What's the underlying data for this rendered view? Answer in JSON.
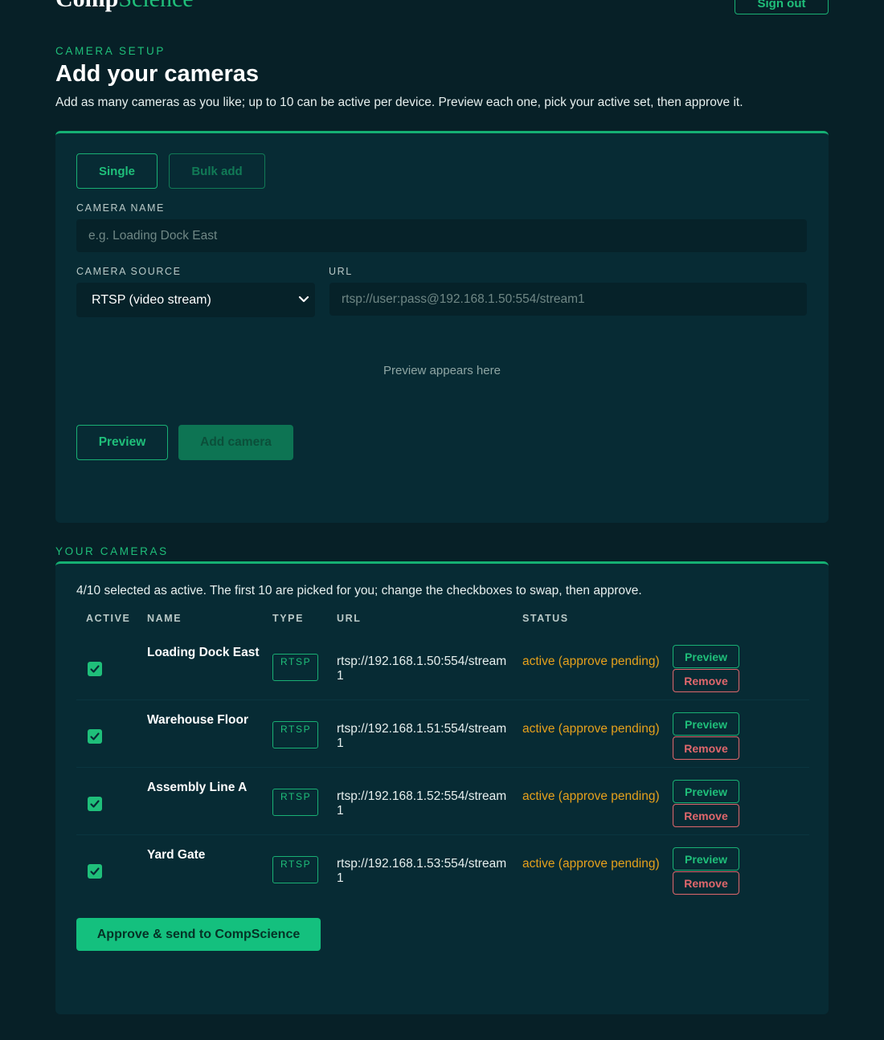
{
  "header": {
    "logo_part1": "Comp",
    "logo_part2": "Science",
    "signout_label": "Sign out"
  },
  "setup": {
    "eyebrow": "CAMERA SETUP",
    "title": "Add your cameras",
    "intro": "Add as many cameras as you like; up to 10 can be active per device. Preview each one, pick your active set, then approve it."
  },
  "form": {
    "mode_single": "Single",
    "mode_bulk": "Bulk add",
    "name_label": "CAMERA NAME",
    "name_placeholder": "e.g. Loading Dock East",
    "source_label": "CAMERA SOURCE",
    "source_value": "RTSP (video stream)",
    "url_label": "URL",
    "url_placeholder": "rtsp://user:pass@192.168.1.50:554/stream1",
    "preview_hint": "Preview appears here",
    "preview_button": "Preview",
    "add_button": "Add camera"
  },
  "cameras": {
    "eyebrow": "YOUR CAMERAS",
    "summary": "4/10 selected as active. The first 10 are picked for you; change the checkboxes to swap, then approve.",
    "columns": {
      "active": "ACTIVE",
      "name": "NAME",
      "type": "TYPE",
      "url": "URL",
      "status": "STATUS"
    },
    "rows": [
      {
        "name": "Loading Dock East",
        "type": "RTSP",
        "url": "rtsp://192.168.1.50:554/stream1",
        "status": "active (approve pending)",
        "preview": "Preview",
        "remove": "Remove"
      },
      {
        "name": "Warehouse Floor",
        "type": "RTSP",
        "url": "rtsp://192.168.1.51:554/stream1",
        "status": "active (approve pending)",
        "preview": "Preview",
        "remove": "Remove"
      },
      {
        "name": "Assembly Line A",
        "type": "RTSP",
        "url": "rtsp://192.168.1.52:554/stream1",
        "status": "active (approve pending)",
        "preview": "Preview",
        "remove": "Remove"
      },
      {
        "name": "Yard Gate",
        "type": "RTSP",
        "url": "rtsp://192.168.1.53:554/stream1",
        "status": "active (approve pending)",
        "preview": "Preview",
        "remove": "Remove"
      }
    ],
    "approve_button": "Approve & send to CompScience"
  },
  "colors": {
    "background": "#072027",
    "card": "#072b34",
    "accent": "#1fbf7a",
    "status": "#e5a11c",
    "danger": "#e0676c"
  }
}
